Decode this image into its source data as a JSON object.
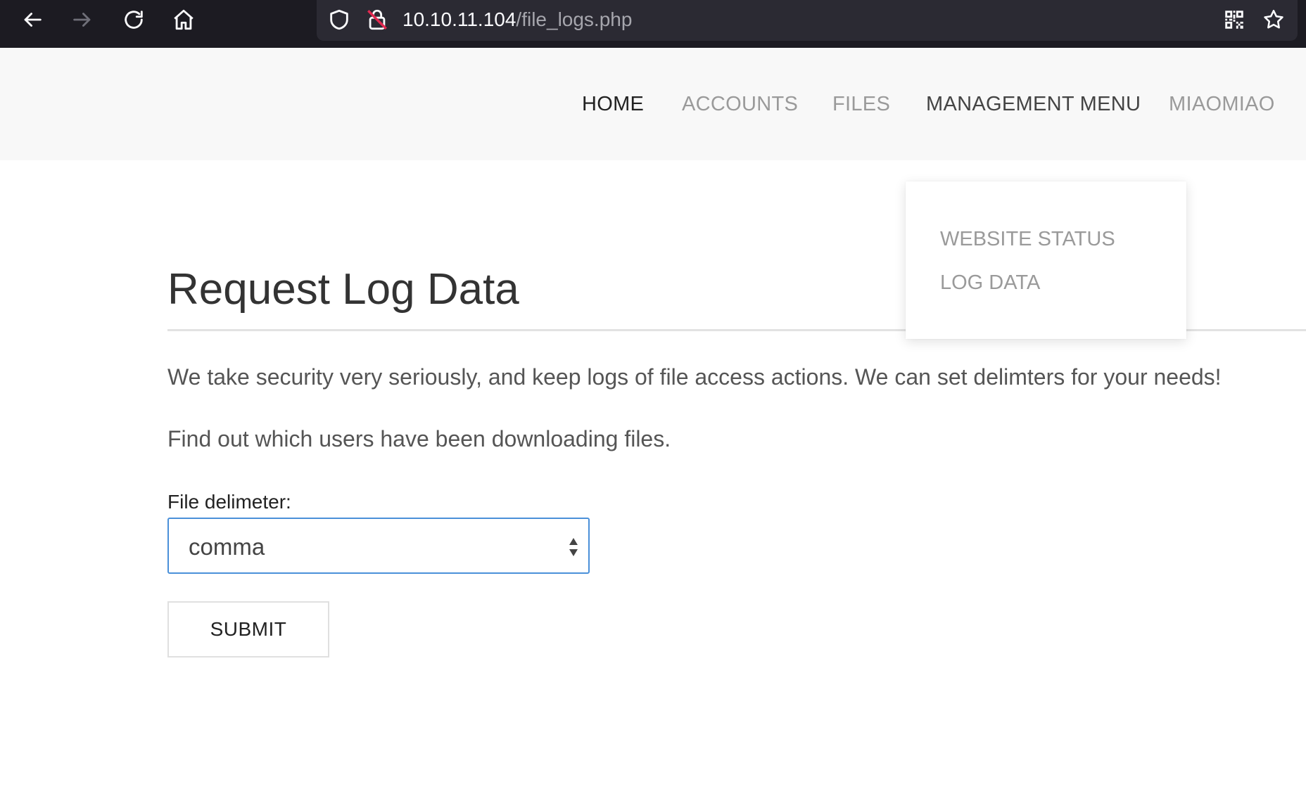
{
  "browser": {
    "url_host": "10.10.11.104",
    "url_path": "/file_logs.php",
    "icons": {
      "back": "arrow-left-icon",
      "forward": "arrow-right-icon",
      "reload": "reload-icon",
      "home": "home-icon",
      "tracking": "shield-icon",
      "insecure": "lock-insecure-icon",
      "qr": "qr-code-icon",
      "bookmark": "star-icon"
    }
  },
  "nav": {
    "items": [
      {
        "label": "HOME"
      },
      {
        "label": "ACCOUNTS"
      },
      {
        "label": "FILES"
      },
      {
        "label": "MANAGEMENT MENU"
      },
      {
        "label": "MIAOMIAO"
      }
    ]
  },
  "dropdown": {
    "items": [
      {
        "label": "WEBSITE STATUS"
      },
      {
        "label": "LOG DATA"
      }
    ]
  },
  "main": {
    "title": "Request Log Data",
    "paragraph1": "We take security very seriously, and keep logs of file access actions. We can set delimters for your needs!",
    "paragraph2": "Find out which users have been downloading files.",
    "form": {
      "label": "File delimeter:",
      "selected": "comma",
      "submit_label": "SUBMIT"
    }
  },
  "colors": {
    "chrome_bg": "#1c1b22",
    "url_bar_bg": "#2b2a33",
    "header_bg": "#f8f8f8",
    "focus_border": "#4a90d9"
  }
}
